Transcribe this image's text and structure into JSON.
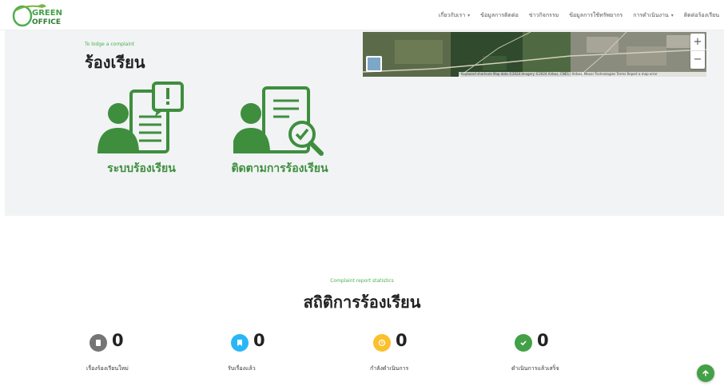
{
  "header": {
    "logo_text_top": "GREEN",
    "logo_text_bottom": "OFFICE",
    "nav": [
      {
        "label": "เกี่ยวกับเรา",
        "dropdown": true
      },
      {
        "label": "ข้อมูลการติดต่อ",
        "dropdown": false
      },
      {
        "label": "ข่าวกิจกรรม",
        "dropdown": false
      },
      {
        "label": "ข้อมูลการใช้ทรัพยากร",
        "dropdown": false
      },
      {
        "label": "การดำเนินงาน",
        "dropdown": true
      },
      {
        "label": "ติดต่อร้องเรียน",
        "dropdown": false
      }
    ]
  },
  "hero": {
    "subtitle": "To lodge a complaint",
    "title": "ร้องเรียน",
    "cards": [
      {
        "label": "ระบบร้องเรียน",
        "icon": "person-document-alert-icon"
      },
      {
        "label": "ติดตามการร้องเรียน",
        "icon": "person-document-search-icon"
      }
    ],
    "map": {
      "zoom_in": "+",
      "zoom_out": "−",
      "attribution": "Keyboard shortcuts   Map data ©2024 Imagery ©2024 Airbus, CNES / Airbus, Maxar Technologies   Terms   Report a map error"
    }
  },
  "stats": {
    "subtitle": "Complaint report statistics",
    "title": "สถิติการร้องเรียน",
    "items": [
      {
        "count": "0",
        "label": "เรื่องร้องเรียนใหม่",
        "icon": "document-icon",
        "color": "#757575"
      },
      {
        "count": "0",
        "label": "รับเรื่องแล้ว",
        "icon": "bookmark-icon",
        "color": "#29b6f6"
      },
      {
        "count": "0",
        "label": "กำลังดำเนินการ",
        "icon": "clock-icon",
        "color": "#fbc02d"
      },
      {
        "count": "0",
        "label": "ดำเนินการแล้วเสร็จ",
        "icon": "check-icon",
        "color": "#43a047"
      }
    ]
  },
  "colors": {
    "accent_green": "#3e8e3e",
    "hero_bg": "#f1f3f4"
  }
}
